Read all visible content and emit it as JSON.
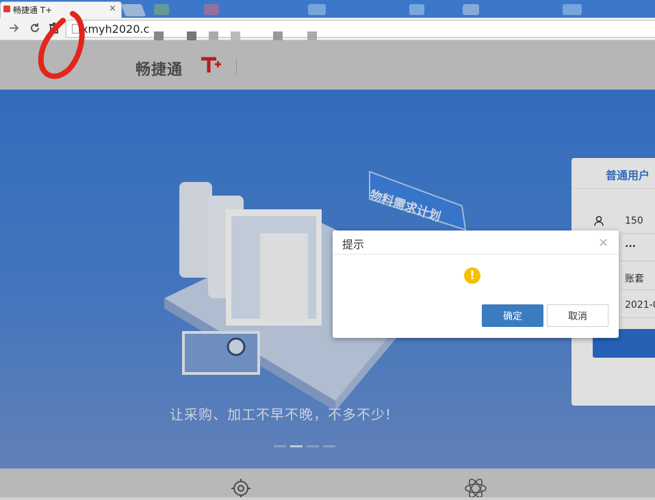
{
  "browser": {
    "tab_title": "畅捷通 T+",
    "tab_close": "×",
    "url_text": "xmyh2020.c"
  },
  "header": {
    "logo_text": "畅捷通",
    "logo_mark": "T+"
  },
  "hero": {
    "plan_sign": "物料需求计划",
    "slogan": "让采购、加工不早不晚，不多不少!"
  },
  "login": {
    "tab_label": "普通用户",
    "username_value": "150",
    "password_value": "...",
    "account_label": "账套",
    "date_value": "2021-0"
  },
  "dialog": {
    "title": "提示",
    "close_symbol": "×",
    "warning_symbol": "!",
    "ok_label": "确定",
    "cancel_label": "取消"
  },
  "colors": {
    "hero_blue": "#3b7cd6",
    "ok_button": "#3b7bbf",
    "warning": "#f5c000",
    "login_tab": "#3a7bd5"
  }
}
